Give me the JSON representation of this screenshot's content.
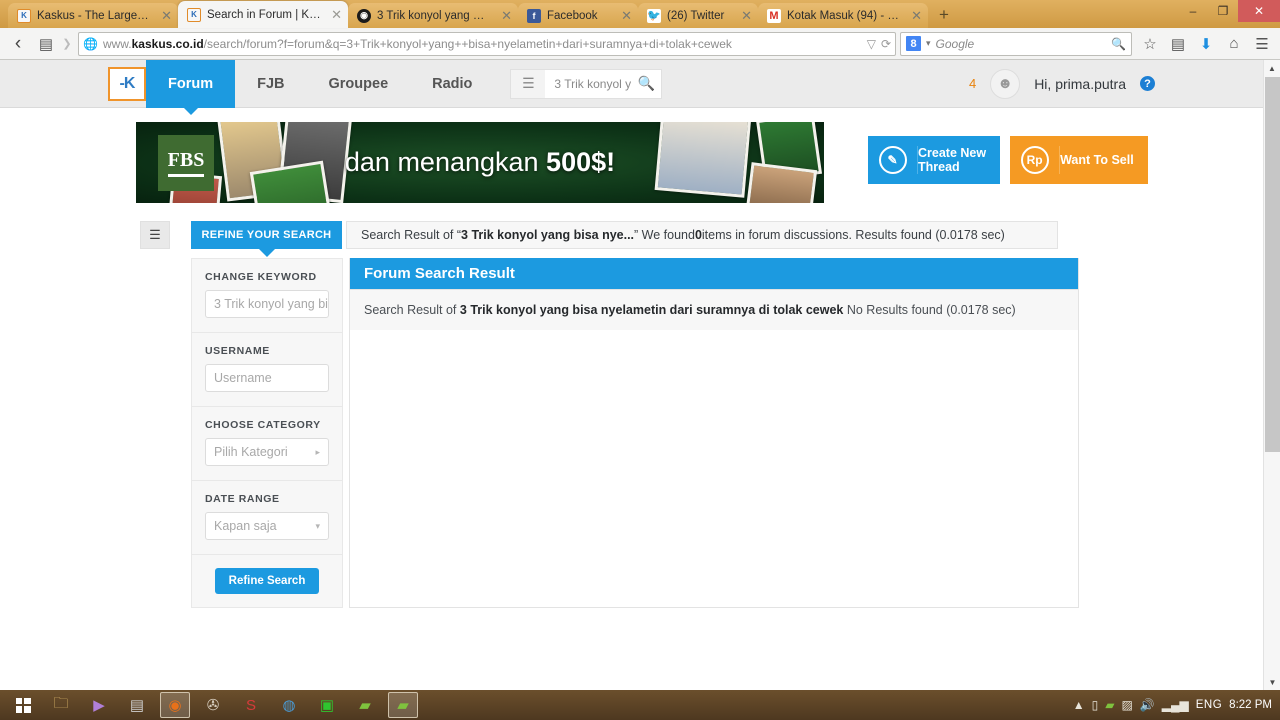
{
  "browser": {
    "tabs": [
      {
        "title": "Kaskus - The Largest Ind...",
        "favicon": "kaskus-icon",
        "active": false
      },
      {
        "title": "Search in Forum | Kasku...",
        "favicon": "kaskus-icon",
        "active": true
      },
      {
        "title": "3 Trik konyol yang mun...",
        "favicon": "dark-circle-icon",
        "active": false
      },
      {
        "title": "Facebook",
        "favicon": "facebook-icon",
        "active": false
      },
      {
        "title": "(26) Twitter",
        "favicon": "twitter-icon",
        "active": false
      },
      {
        "title": "Kotak Masuk (94) - prim...",
        "favicon": "gmail-icon",
        "active": false
      }
    ],
    "new_tab_label": "+",
    "window_controls": {
      "minimize": "–",
      "restore": "❐",
      "close": "✕"
    },
    "nav": {
      "back_icon": "back-arrow-icon",
      "bookmarks_icon": "bookmarks-icon",
      "site_icon": "globe-icon",
      "url_host_prefix": "www.",
      "url_host": "kaskus.co.id",
      "url_path": "/search/forum?f=forum&q=3+Trik+konyol+yang++bisa+nyelametin+dari+suramnya+di+tolak+cewek",
      "dropdown_icon": "▽",
      "reload_icon": "⟳"
    },
    "search": {
      "engine_badge": "8",
      "engine_caret": "▾",
      "placeholder": "Google",
      "go_icon": "search-icon"
    },
    "toolbar_icons": {
      "bookmark_star": "☆",
      "reader": "bookmarks-list-icon",
      "downloads": "⬇",
      "home": "home-icon",
      "menu": "☰"
    }
  },
  "site": {
    "logo_text": "-K",
    "nav_items": [
      {
        "label": "Forum",
        "active": true
      },
      {
        "label": "FJB",
        "active": false
      },
      {
        "label": "Groupee",
        "active": false
      },
      {
        "label": "Radio",
        "active": false
      }
    ],
    "header_search": {
      "list_icon": "list-icon",
      "value": "3 Trik konyol ya",
      "search_icon": "search-icon"
    },
    "notification_count": "4",
    "greeting": "Hi, prima.putra",
    "help_icon_label": "?"
  },
  "banner": {
    "sponsor": "FBS",
    "text_plain": "dan menangkan ",
    "text_bold": "500$!"
  },
  "actions": {
    "create_thread": {
      "label": "Create New Thread",
      "line1": "Create New",
      "line2": "Thread",
      "icon": "pencil-icon",
      "color": "#1c9ae0"
    },
    "want_to_sell": {
      "label": "Want To Sell",
      "icon_text": "Rp",
      "color": "#f59a23"
    }
  },
  "search_bar": {
    "list_toggle_icon": "list-toggle-icon",
    "refine_tab_label": "REFINE YOUR SEARCH",
    "summary_prefix": "Search Result of “",
    "summary_query": "3 Trik konyol yang bisa nye...",
    "summary_mid": "” We found ",
    "summary_count": "0",
    "summary_suffix": " items in forum discussions. Results found (0.0178 sec)"
  },
  "refine_panel": {
    "groups": [
      {
        "label": "CHANGE KEYWORD",
        "field_value": "3 Trik konyol yang bi",
        "type": "text",
        "caret": ""
      },
      {
        "label": "USERNAME",
        "field_value": "Username",
        "type": "text",
        "caret": ""
      },
      {
        "label": "CHOOSE CATEGORY",
        "field_value": "Pilih Kategori",
        "type": "select",
        "caret": "▸"
      },
      {
        "label": "DATE RANGE",
        "field_value": "Kapan saja",
        "type": "select",
        "caret": "▾"
      }
    ],
    "submit_label": "Refine Search"
  },
  "results": {
    "header": "Forum Search Result",
    "body_prefix": "Search Result of ",
    "body_query": "3 Trik konyol yang bisa nyelametin dari suramnya di tolak cewek",
    "body_suffix": " No Results found (0.0178 sec)"
  },
  "scrollbar": {
    "up_icon": "▲",
    "down_icon": "▼"
  },
  "taskbar": {
    "start_label": "start-icon",
    "items": [
      {
        "name": "file-explorer-icon",
        "glyph": "🗀",
        "running": false,
        "color": "#e8c070"
      },
      {
        "name": "media-player-icon",
        "glyph": "▶",
        "running": false,
        "color": "#b07fd8"
      },
      {
        "name": "video-editor-icon",
        "glyph": "▤",
        "running": false,
        "color": "#cfcfcf"
      },
      {
        "name": "firefox-icon",
        "glyph": "◉",
        "running": true,
        "color": "#e8711a"
      },
      {
        "name": "utorrent-icon",
        "glyph": "✇",
        "running": false,
        "color": "#d8cfc0"
      },
      {
        "name": "idm-s-icon",
        "glyph": "S",
        "running": false,
        "color": "#d63a3a"
      },
      {
        "name": "download-manager-icon",
        "glyph": "◍",
        "running": false,
        "color": "#4a9ad4"
      },
      {
        "name": "messenger-icon",
        "glyph": "▣",
        "running": false,
        "color": "#2fc52f"
      },
      {
        "name": "stack-app-icon",
        "glyph": "▰",
        "running": false,
        "color": "#7fc23e"
      },
      {
        "name": "stack-app-window-icon",
        "glyph": "▰",
        "running": true,
        "color": "#7fc23e"
      }
    ],
    "tray": {
      "expand": "▲",
      "icons": [
        "battery-icon",
        "stack-tray-icon",
        "network-blocked-icon",
        "volume-icon",
        "signal-icon"
      ],
      "language": "ENG",
      "clock": "8:22 PM"
    }
  }
}
